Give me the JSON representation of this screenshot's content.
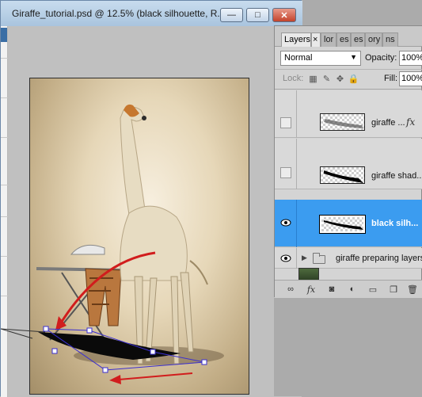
{
  "document": {
    "title": "Giraffe_tutorial.psd @ 12.5% (black silhouette, R...",
    "buttons": {
      "minimize": "—",
      "maximize": "□",
      "close": "✕"
    }
  },
  "layers_panel": {
    "tabs": [
      {
        "label": "Layers",
        "active": true
      },
      {
        "label": "×",
        "active": true
      },
      {
        "label": "lor"
      },
      {
        "label": "es"
      },
      {
        "label": "es"
      },
      {
        "label": "ory"
      },
      {
        "label": "ns"
      }
    ],
    "blend_mode": "Normal",
    "opacity_label": "Opacity:",
    "opacity_value": "100%",
    "lock_label": "Lock:",
    "fill_label": "Fill:",
    "fill_value": "100%",
    "layers": [
      {
        "name": "giraffe ...",
        "visible": false,
        "has_fx": true,
        "fx": "fx"
      },
      {
        "name": "giraffe shad...",
        "visible": false
      },
      {
        "name": "black silh...",
        "visible": true,
        "selected": true
      },
      {
        "name": "giraffe preparing layers",
        "visible": true,
        "is_group": true
      }
    ],
    "footer_icons": [
      "link-icon",
      "fx-icon",
      "mask-icon",
      "adjustment-icon",
      "folder-icon",
      "new-layer-icon",
      "trash-icon"
    ],
    "fx_footer": "fx"
  },
  "colors": {
    "selection": "#3b9cf0",
    "titlebar": "#a9c4de",
    "transform_box": "#3b2fd0",
    "arrow": "#d11d1d"
  }
}
